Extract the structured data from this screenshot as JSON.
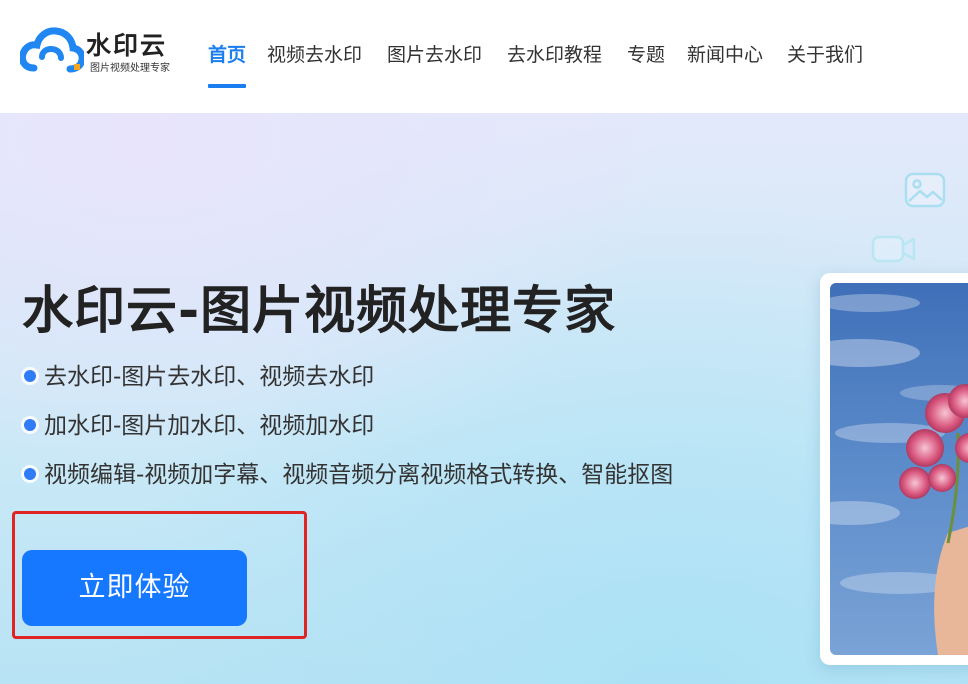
{
  "header": {
    "logo": {
      "name": "水印云",
      "tagline": "图片视频处理专家"
    },
    "nav": [
      {
        "label": "首页",
        "active": true
      },
      {
        "label": "视频去水印",
        "active": false
      },
      {
        "label": "图片去水印",
        "active": false
      },
      {
        "label": "去水印教程",
        "active": false
      },
      {
        "label": "专题",
        "active": false
      },
      {
        "label": "新闻中心",
        "active": false
      },
      {
        "label": "关于我们",
        "active": false
      }
    ]
  },
  "hero": {
    "title": "水印云-图片视频处理专家",
    "features": [
      "去水印-图片去水印、视频去水印",
      "加水印-图片加水印、视频加水印",
      "视频编辑-视频加字幕、视频音频分离视频格式转换、智能抠图"
    ],
    "cta_label": "立即体验"
  },
  "icons": {
    "logo": "cloud-logo-icon",
    "feature_bullet": "bullet-dot-icon",
    "deco_image": "image-icon",
    "deco_video": "video-camera-icon"
  },
  "colors": {
    "accent": "#1a7ef0",
    "cta": "#1677ff",
    "highlight_frame": "#e02424"
  }
}
